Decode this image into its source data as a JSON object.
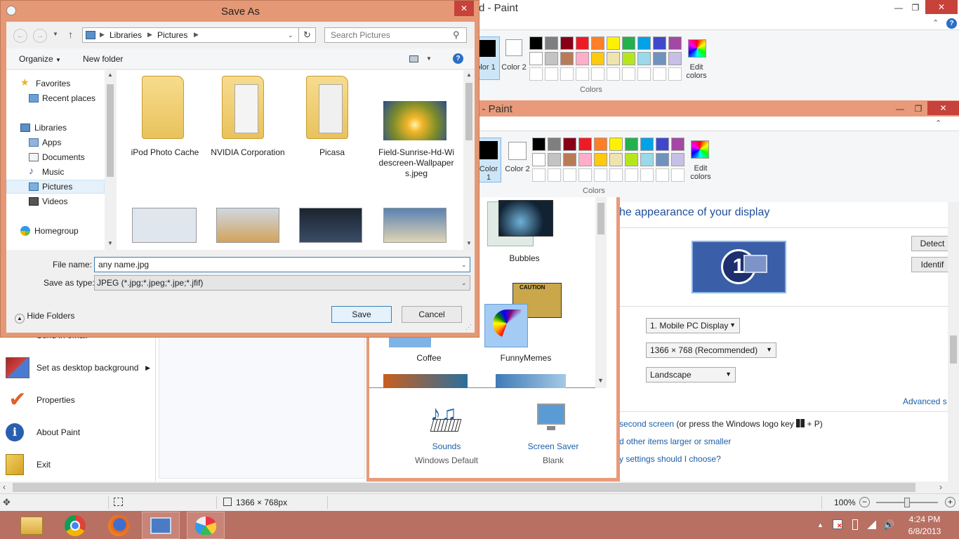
{
  "paint_back": {
    "title": "d - Paint",
    "color1_label": "olor 1",
    "color2_label": "Color 2",
    "edit_colors_label": "Edit colors",
    "colors_group_label": "Colors"
  },
  "paint_mid": {
    "title": "g - Paint",
    "color1_label": "Color 1",
    "color2_label": "Color 2",
    "edit_colors_label": "Edit colors",
    "colors_group_label": "Colors"
  },
  "palette": {
    "row1": [
      "#000000",
      "#7f7f7f",
      "#880015",
      "#ed1c24",
      "#ff7f27",
      "#fff200",
      "#22b14c",
      "#00a2e8",
      "#3f48cc",
      "#a349a4"
    ],
    "row2": [
      "#ffffff",
      "#c3c3c3",
      "#b97a57",
      "#ffaec9",
      "#ffc90e",
      "#efe4b0",
      "#b5e61d",
      "#99d9ea",
      "#7092be",
      "#c8bfe7"
    ]
  },
  "display_panel": {
    "heading": "he appearance of your display",
    "detect_label": "Detect",
    "identify_label": "Identif",
    "monitor_number": "1",
    "display_value": "1. Mobile PC Display",
    "resolution_value": "1366 × 768 (Recommended)",
    "orientation_value": "Landscape",
    "advanced_label": "Advanced s",
    "project_link": "second screen",
    "project_suffix": " (or press the Windows logo key ",
    "project_tail": " + P)",
    "text_size_link": "d other items larger or smaller",
    "choose_link": "y settings should I choose?"
  },
  "themes": {
    "bubbles_label": "Bubbles",
    "coffee_label": "Coffee",
    "funnymemes_label": "FunnyMemes",
    "sounds_label": "Sounds",
    "sounds_value": "Windows Default",
    "screensaver_label": "Screen Saver",
    "screensaver_value": "Blank"
  },
  "paint_menu": {
    "email_label": "Send in email",
    "desktop_bg_label": "Set as desktop background",
    "properties_label": "Properties",
    "about_label": "About Paint",
    "exit_label": "Exit"
  },
  "status_bar": {
    "dimensions": "1366 × 768px",
    "zoom": "100%"
  },
  "save_dialog": {
    "title": "Save As",
    "breadcrumb": [
      "Libraries",
      "Pictures"
    ],
    "search_placeholder": "Search Pictures",
    "organize_label": "Organize",
    "new_folder_label": "New folder",
    "tree": {
      "favorites": "Favorites",
      "recent_places": "Recent places",
      "libraries": "Libraries",
      "apps": "Apps",
      "documents": "Documents",
      "music": "Music",
      "pictures": "Pictures",
      "videos": "Videos",
      "homegroup": "Homegroup"
    },
    "files": [
      {
        "name": "iPod Photo Cache"
      },
      {
        "name": "NVIDIA Corporation"
      },
      {
        "name": "Picasa"
      },
      {
        "name": "Field-Sunrise-Hd-Widescreen-Wallpapers.jpeg"
      }
    ],
    "file_name_label": "File name:",
    "file_name_value": "any name.jpg",
    "save_type_label": "Save as type:",
    "save_type_value": "JPEG (*.jpg;*.jpeg;*.jpe;*.jfif)",
    "hide_folders_label": "Hide Folders",
    "save_label": "Save",
    "cancel_label": "Cancel"
  },
  "taskbar": {
    "time": "4:24 PM",
    "date": "6/8/2013"
  }
}
